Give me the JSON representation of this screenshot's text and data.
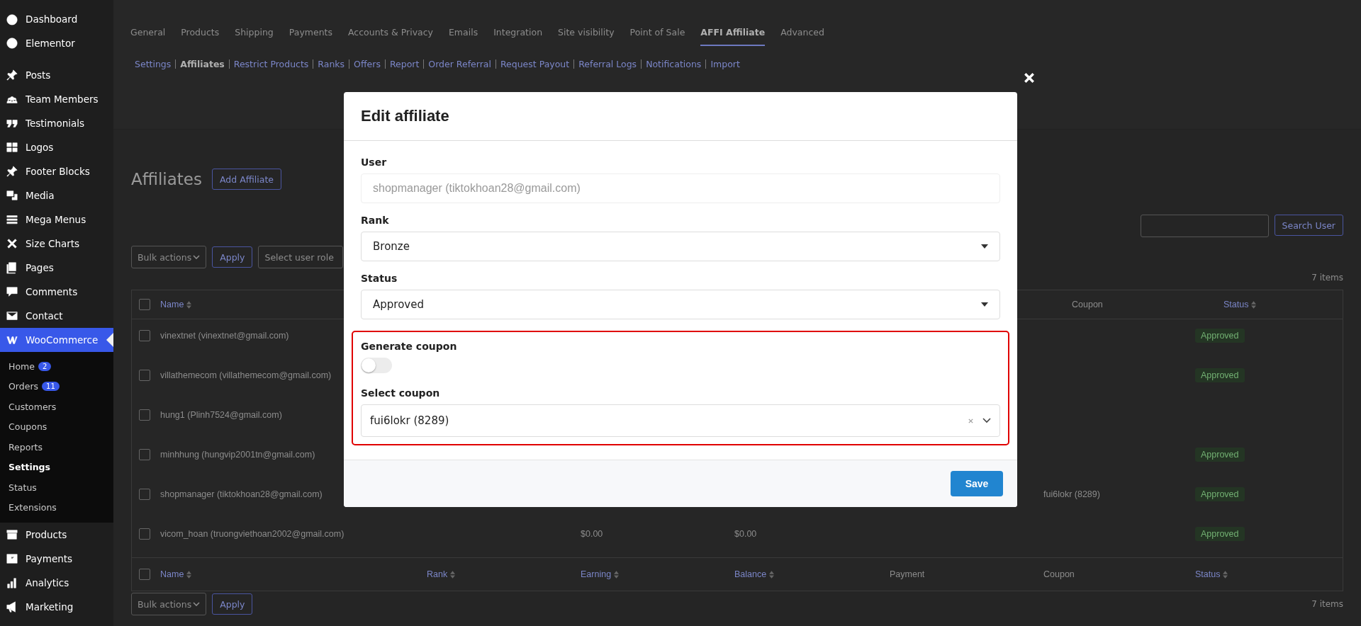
{
  "sidebar": {
    "groups": [
      {
        "items": [
          {
            "label": "Dashboard",
            "selected": false
          },
          {
            "label": "Elementor",
            "selected": false
          }
        ]
      },
      {
        "items": [
          {
            "label": "Posts",
            "selected": false
          },
          {
            "label": "Team Members",
            "selected": false
          },
          {
            "label": "Testimonials",
            "selected": false
          },
          {
            "label": "Logos",
            "selected": false
          },
          {
            "label": "Footer Blocks",
            "selected": false
          },
          {
            "label": "Media",
            "selected": false
          },
          {
            "label": "Mega Menus",
            "selected": false
          },
          {
            "label": "Size Charts",
            "selected": false
          },
          {
            "label": "Pages",
            "selected": false
          },
          {
            "label": "Comments",
            "selected": false
          },
          {
            "label": "Contact",
            "selected": false
          },
          {
            "label": "WooCommerce",
            "selected": true,
            "children": [
              {
                "label": "Home",
                "badge": "2",
                "selected": false
              },
              {
                "label": "Orders",
                "badge": "11",
                "selected": false
              },
              {
                "label": "Customers",
                "selected": false
              },
              {
                "label": "Coupons",
                "selected": false
              },
              {
                "label": "Reports",
                "selected": false
              },
              {
                "label": "Settings",
                "selected": true
              },
              {
                "label": "Status",
                "selected": false
              },
              {
                "label": "Extensions",
                "selected": false
              }
            ]
          },
          {
            "label": "Products",
            "selected": false
          },
          {
            "label": "Payments",
            "selected": false
          },
          {
            "label": "Analytics",
            "selected": false
          },
          {
            "label": "Marketing",
            "selected": false
          }
        ]
      }
    ]
  },
  "tabs": [
    {
      "label": "General",
      "selected": false
    },
    {
      "label": "Products",
      "selected": false
    },
    {
      "label": "Shipping",
      "selected": false
    },
    {
      "label": "Payments",
      "selected": false
    },
    {
      "label": "Accounts & Privacy",
      "selected": false
    },
    {
      "label": "Emails",
      "selected": false
    },
    {
      "label": "Integration",
      "selected": false
    },
    {
      "label": "Site visibility",
      "selected": false
    },
    {
      "label": "Point of Sale",
      "selected": false
    },
    {
      "label": "AFFI Affiliate",
      "selected": true
    },
    {
      "label": "Advanced",
      "selected": false
    }
  ],
  "subnav": [
    {
      "label": "Settings",
      "selected": false
    },
    {
      "label": "Affiliates",
      "selected": true
    },
    {
      "label": "Restrict Products",
      "selected": false
    },
    {
      "label": "Ranks",
      "selected": false
    },
    {
      "label": "Offers",
      "selected": false
    },
    {
      "label": "Report",
      "selected": false
    },
    {
      "label": "Order Referral",
      "selected": false
    },
    {
      "label": "Request Payout",
      "selected": false
    },
    {
      "label": "Referral Logs",
      "selected": false
    },
    {
      "label": "Notifications",
      "selected": false
    },
    {
      "label": "Import",
      "selected": false
    }
  ],
  "page": {
    "title": "Affiliates",
    "add_button": "Add Affiliate",
    "search_button": "Search User",
    "bulk_actions": "Bulk actions",
    "apply": "Apply",
    "role_filter": "Select user role",
    "item_count": "7 items",
    "bulk_actions_bottom": "Bulk actions",
    "apply_bottom": "Apply",
    "item_count_bottom": "7 items"
  },
  "table": {
    "header_checked": false,
    "footer_checked": false,
    "header_top": [
      {
        "label": "Name",
        "sortable": true
      },
      {
        "label": "Coupon",
        "sortable": false
      },
      {
        "label": "Status",
        "sortable": true
      }
    ],
    "columns": [
      {
        "label": "Name",
        "sortable": true
      },
      {
        "label": "Rank",
        "sortable": true
      },
      {
        "label": "Earning",
        "sortable": true
      },
      {
        "label": "Balance",
        "sortable": true
      },
      {
        "label": "Payment",
        "sortable": false
      },
      {
        "label": "Coupon",
        "sortable": false
      },
      {
        "label": "Status",
        "sortable": true
      }
    ],
    "rows": [
      {
        "checked": false,
        "name": "vinextnet (vinextnet@gmail.com)",
        "status": "Approved"
      },
      {
        "checked": false,
        "name": "villathemecom (villathemecom@gmail.com)",
        "status": "Approved"
      },
      {
        "checked": false,
        "name": "hung1 (Plinh7524@gmail.com)"
      },
      {
        "checked": false,
        "name": "minhhung (hungvip2001tn@gmail.com)",
        "status": "Approved"
      },
      {
        "checked": false,
        "name": "shopmanager (tiktokhoan28@gmail.com)",
        "coupon": "fui6lokr (8289)",
        "status": "Approved"
      },
      {
        "checked": false,
        "name": "vicom_hoan (truongviethoan2002@gmail.com)",
        "earning": "$0.00",
        "balance": "$0.00",
        "status": "Approved"
      }
    ]
  },
  "modal": {
    "title": "Edit affiliate",
    "user_label": "User",
    "user_value": "shopmanager (tiktokhoan28@gmail.com)",
    "rank_label": "Rank",
    "rank_value": "Bronze",
    "status_label": "Status",
    "status_value": "Approved",
    "generate_label": "Generate coupon",
    "generate_on": false,
    "coupon_label": "Select coupon",
    "coupon_value": "fui6lokr (8289)",
    "save": "Save"
  }
}
